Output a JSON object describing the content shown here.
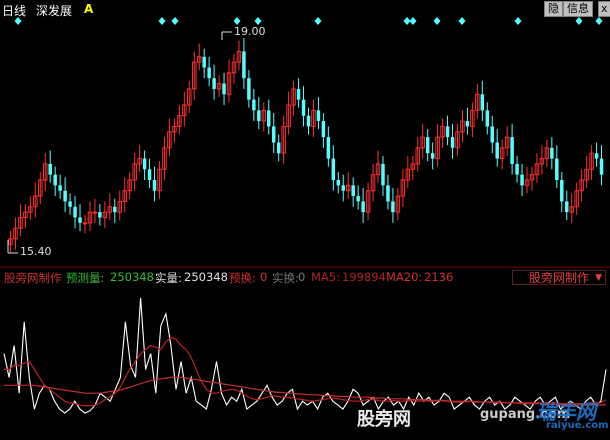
{
  "topbar": {
    "period": "日线",
    "stock_name": "深发展",
    "flag": "A",
    "btn_tie": "隐",
    "btn_info": "信息",
    "btn_close": "x"
  },
  "price_panel": {
    "high_label": "19.00",
    "low_label": "15.40"
  },
  "indicator": {
    "name": "股旁网制作",
    "pred_label": "预测量:",
    "pred_value": "250348",
    "real_label": "实量:",
    "real_value": "250348",
    "hs_label": "预换:",
    "hs_value": "0",
    "sh_label": "实换:",
    "sh_value": "0",
    "ma5_label": "MA5:",
    "ma5_value": "199894",
    "ma20_label": "MA20:",
    "ma20_value": "2136",
    "selector": "股旁网制作"
  },
  "colors": {
    "up": "#ff3030",
    "down": "#54ffff",
    "marker": "#54ffff",
    "volume_line": "#ffffff",
    "ma5_line": "#c02020",
    "ma20_line": "#c03030"
  },
  "watermark": {
    "left": "股旁网",
    "middle": "gupang.com",
    "right_cn": "瑞丰网",
    "right_en": "raiyue.com"
  },
  "chart_data": [
    {
      "type": "candlestick",
      "title": "",
      "y_high_marker": 19.0,
      "y_low_marker": 15.4,
      "ylim": [
        15.2,
        19.4
      ],
      "closes": [
        15.5,
        15.7,
        15.9,
        16.0,
        16.1,
        16.3,
        16.6,
        16.9,
        16.7,
        16.5,
        16.4,
        16.2,
        16.1,
        15.9,
        15.8,
        15.8,
        16.0,
        16.0,
        15.9,
        16.0,
        16.1,
        16.0,
        16.2,
        16.4,
        16.6,
        16.9,
        17.0,
        16.8,
        16.6,
        16.4,
        16.8,
        17.2,
        17.5,
        17.6,
        17.8,
        18.0,
        18.3,
        18.8,
        18.9,
        18.7,
        18.5,
        18.3,
        18.4,
        18.2,
        18.6,
        18.8,
        19.0,
        18.5,
        18.1,
        17.9,
        17.7,
        17.9,
        17.6,
        17.3,
        17.1,
        17.6,
        18.0,
        18.3,
        18.1,
        17.8,
        17.6,
        17.9,
        17.7,
        17.4,
        17.0,
        16.6,
        16.5,
        16.4,
        16.5,
        16.3,
        16.2,
        16.0,
        16.4,
        16.7,
        16.9,
        16.5,
        16.2,
        16.0,
        16.3,
        16.6,
        16.8,
        16.9,
        17.2,
        17.4,
        17.1,
        17.0,
        17.4,
        17.6,
        17.4,
        17.2,
        17.5,
        17.7,
        17.6,
        17.9,
        18.2,
        17.9,
        17.6,
        17.3,
        17.0,
        17.2,
        17.4,
        16.9,
        16.7,
        16.5,
        16.6,
        16.7,
        16.9,
        17.0,
        17.2,
        17.0,
        16.6,
        16.2,
        16.0,
        16.1,
        16.4,
        16.6,
        16.8,
        17.1,
        17.0,
        16.7
      ],
      "event_markers": 13
    },
    {
      "type": "line",
      "title": "",
      "series": [
        {
          "name": "预测量",
          "values": [
            90,
            60,
            100,
            40,
            130,
            60,
            20,
            40,
            50,
            45,
            30,
            20,
            15,
            20,
            30,
            20,
            15,
            18,
            25,
            40,
            35,
            30,
            45,
            60,
            130,
            75,
            60,
            160,
            70,
            90,
            40,
            125,
            140,
            100,
            45,
            80,
            40,
            60,
            30,
            25,
            20,
            45,
            80,
            40,
            25,
            35,
            30,
            45,
            20,
            25,
            30,
            40,
            50,
            35,
            25,
            30,
            40,
            45,
            20,
            30,
            25,
            30,
            20,
            35,
            40,
            30,
            25,
            20,
            30,
            45,
            40,
            25,
            30,
            35,
            20,
            30,
            35,
            25,
            30,
            20,
            35,
            25,
            40,
            30,
            35,
            25,
            30,
            40,
            35,
            20,
            25,
            30,
            35,
            25,
            20,
            30,
            35,
            25,
            30,
            20,
            25,
            35,
            30,
            25,
            20,
            30,
            35,
            25,
            30,
            35,
            20,
            25,
            30,
            25,
            20,
            30,
            35,
            25,
            30,
            70
          ]
        },
        {
          "name": "MA5",
          "values": [
            70,
            70,
            75,
            75,
            78,
            80,
            70,
            60,
            50,
            45,
            40,
            35,
            30,
            28,
            27,
            25,
            24,
            24,
            25,
            28,
            32,
            36,
            40,
            48,
            60,
            72,
            80,
            90,
            95,
            100,
            98,
            95,
            105,
            110,
            108,
            100,
            95,
            85,
            70,
            55,
            45,
            40,
            40,
            42,
            44,
            45,
            44,
            40,
            36,
            33,
            32,
            33,
            35,
            37,
            36,
            35,
            35,
            34,
            33,
            32,
            31,
            30,
            31,
            32,
            33,
            34,
            33,
            32,
            31,
            30,
            30,
            31,
            32,
            32,
            31,
            30,
            30,
            31,
            30,
            30,
            31,
            30,
            30,
            31,
            30,
            30,
            31,
            30,
            30,
            29,
            29,
            29,
            30,
            30,
            29,
            29,
            29,
            29,
            29,
            28,
            28,
            28,
            28,
            28,
            28,
            28,
            28,
            28,
            28,
            28,
            27,
            27,
            27,
            27,
            27,
            27,
            28,
            28,
            28,
            32
          ]
        },
        {
          "name": "MA20",
          "values": [
            50,
            50,
            50,
            50,
            50,
            50,
            50,
            49,
            48,
            47,
            46,
            45,
            44,
            43,
            42,
            41,
            40,
            40,
            40,
            40,
            41,
            42,
            43,
            44,
            46,
            48,
            50,
            52,
            54,
            56,
            57,
            58,
            59,
            60,
            60,
            60,
            59,
            58,
            57,
            56,
            55,
            54,
            53,
            52,
            51,
            50,
            49,
            48,
            47,
            46,
            45,
            44,
            43,
            42,
            41,
            41,
            40,
            40,
            39,
            39,
            38,
            38,
            38,
            37,
            37,
            37,
            36,
            36,
            36,
            35,
            35,
            35,
            35,
            34,
            34,
            34,
            33,
            33,
            33,
            33,
            32,
            32,
            32,
            32,
            31,
            31,
            31,
            31,
            30,
            30,
            30,
            30,
            30,
            29,
            29,
            29,
            29,
            28,
            28,
            28,
            28,
            28,
            27,
            27,
            27,
            27,
            27,
            26,
            26,
            26,
            26,
            26,
            26,
            25,
            25,
            25,
            25,
            25,
            25,
            26
          ]
        }
      ]
    }
  ]
}
